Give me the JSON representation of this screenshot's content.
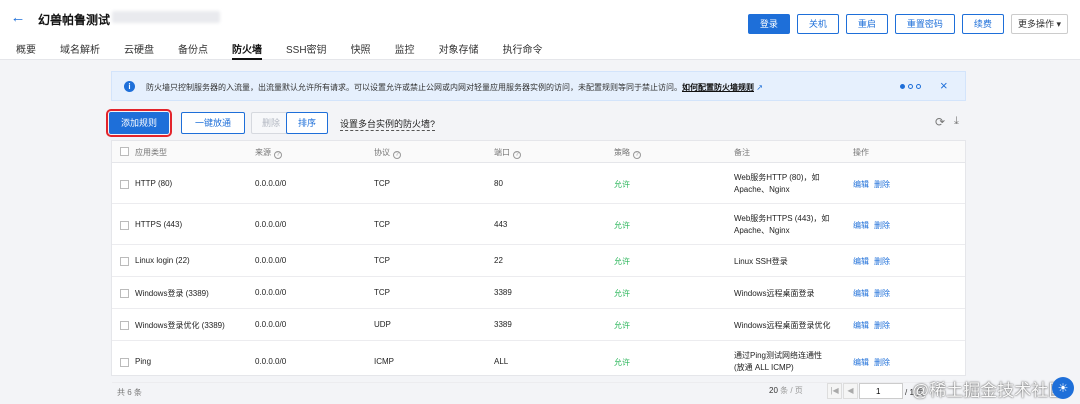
{
  "header": {
    "title": "幻兽帕鲁测试",
    "actions": [
      "登录",
      "关机",
      "重启",
      "重置密码",
      "续费",
      "更多操作"
    ]
  },
  "tabs": [
    "概要",
    "域名解析",
    "云硬盘",
    "备份点",
    "防火墙",
    "SSH密钥",
    "快照",
    "监控",
    "对象存储",
    "执行命令"
  ],
  "active_tab": "防火墙",
  "notice": {
    "text": "防火墙只控制服务器的入流量，出流量默认允许所有请求。可以设置允许或禁止公网或内网对轻量应用服务器实例的访问，未配置规则等同于禁止访问。",
    "link": "如何配置防火墙规则",
    "link_icon": "external-link-icon",
    "close": "×"
  },
  "toolbar": {
    "add": "添加规则",
    "open_one_click": "一键放通",
    "delete": "删除",
    "sort": "排序",
    "multi_instance": "设置多台实例的防火墙?"
  },
  "table": {
    "columns": [
      "应用类型",
      "来源",
      "协议",
      "端口",
      "策略",
      "备注",
      "操作"
    ],
    "rows": [
      {
        "app": "HTTP (80)",
        "source": "0.0.0.0/0",
        "protocol": "TCP",
        "port": "80",
        "policy": "允许",
        "note": "Web服务HTTP (80)，如 Apache、Nginx",
        "edit": "编辑",
        "delete": "删除"
      },
      {
        "app": "HTTPS (443)",
        "source": "0.0.0.0/0",
        "protocol": "TCP",
        "port": "443",
        "policy": "允许",
        "note": "Web服务HTTPS (443)，如 Apache、Nginx",
        "edit": "编辑",
        "delete": "删除"
      },
      {
        "app": "Linux login (22)",
        "source": "0.0.0.0/0",
        "protocol": "TCP",
        "port": "22",
        "policy": "允许",
        "note": "Linux SSH登录",
        "edit": "编辑",
        "delete": "删除"
      },
      {
        "app": "Windows登录 (3389)",
        "source": "0.0.0.0/0",
        "protocol": "TCP",
        "port": "3389",
        "policy": "允许",
        "note": "Windows远程桌面登录",
        "edit": "编辑",
        "delete": "删除"
      },
      {
        "app": "Windows登录优化 (3389)",
        "source": "0.0.0.0/0",
        "protocol": "UDP",
        "port": "3389",
        "policy": "允许",
        "note": "Windows远程桌面登录优化",
        "edit": "编辑",
        "delete": "删除"
      },
      {
        "app": "Ping",
        "source": "0.0.0.0/0",
        "protocol": "ICMP",
        "port": "ALL",
        "policy": "允许",
        "note": "通过Ping测试网络连通性 (放通 ALL ICMP)",
        "edit": "编辑",
        "delete": "删除"
      }
    ]
  },
  "footer": {
    "total": "共 6 条",
    "page_size": "20",
    "page_size_unit": "条 / 页",
    "page": "1",
    "page_total": "/ 1 页"
  },
  "watermark": "@稀土掘金技术社区",
  "colors": {
    "accent": "#1e6fd9",
    "allow": "#2bb65a",
    "highlight": "#e3242b"
  }
}
